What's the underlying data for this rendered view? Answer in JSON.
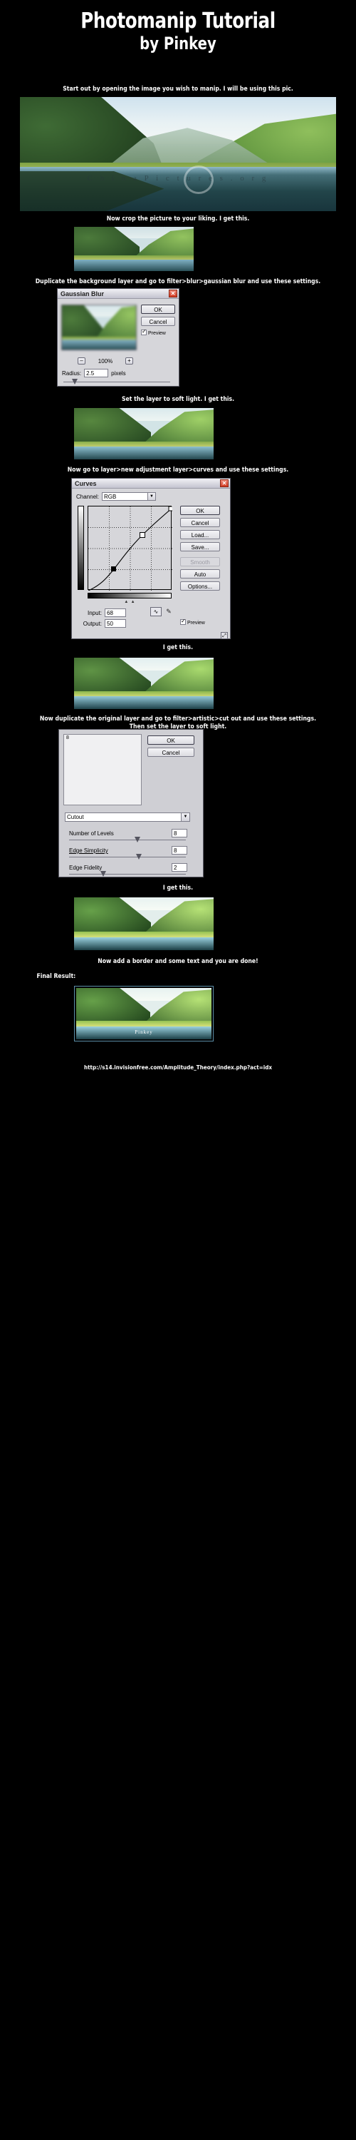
{
  "header": {
    "title": "Photomanip Tutorial",
    "subtitle": "by Pinkey"
  },
  "steps": [
    {
      "id": "step1",
      "text": "Start out by opening the image you wish to manip. I will be using this pic."
    },
    {
      "id": "step2",
      "text": "Now crop the picture to your liking. I get this."
    },
    {
      "id": "step3",
      "text": "Duplicate the background layer and go to filter>blur>gaussian blur and use these settings."
    },
    {
      "id": "step4",
      "text": "Set the layer to soft light. I get this."
    },
    {
      "id": "step5",
      "text": "Now go to layer>new adjustment layer>curves and use these settings."
    },
    {
      "id": "step6",
      "text": "I get this."
    },
    {
      "id": "step7",
      "text": "Now duplicate the original layer and go to filter>artistic>cut out and use these settings. Then set the layer to soft light."
    },
    {
      "id": "step8",
      "text": "I get this."
    },
    {
      "id": "step9",
      "text": "Now add a border and some text and you are done!"
    },
    {
      "id": "step10",
      "text": "Final Result:"
    }
  ],
  "photos": {
    "original": {
      "watermark": "C h i n a P i c t u r e s . o r g"
    },
    "final": {
      "signature": "Pinkey"
    }
  },
  "gaussian_blur": {
    "title": "Gaussian Blur",
    "close_label": "✕",
    "ok": "OK",
    "cancel": "Cancel",
    "preview_label": "Preview",
    "preview_checked": true,
    "zoom_out": "–",
    "zoom_level": "100%",
    "zoom_in": "+",
    "radius_label": "Radius:",
    "radius_value": "2.5",
    "radius_unit": "pixels"
  },
  "curves": {
    "title": "Curves",
    "close_label": "✕",
    "channel_label": "Channel:",
    "channel_value": "RGB",
    "buttons": [
      "OK",
      "Cancel",
      "Load...",
      "Save...",
      "Smooth",
      "Auto",
      "Options..."
    ],
    "smooth_disabled": true,
    "input_label": "Input:",
    "input_value": "68",
    "output_label": "Output:",
    "output_value": "50",
    "preview_label": "Preview",
    "preview_checked": true
  },
  "cutout": {
    "ok": "OK",
    "cancel": "Cancel",
    "zoom_level": "8",
    "filter_name": "Cutout",
    "params": [
      {
        "label": "Number of Levels",
        "value": "8"
      },
      {
        "label": "Edge Simplicity",
        "value": "8"
      },
      {
        "label": "Edge Fidelity",
        "value": "2"
      }
    ]
  },
  "footer": {
    "url": "http://s14.invisionfree.com/Amplitude_Theory/index.php?act=idx"
  },
  "colors": {
    "background": "#000000",
    "text": "#ffffff",
    "dialog_face": "#d6d6da",
    "dialog_border": "#5b5b66",
    "close_red": "#cf3a22",
    "final_border": "#5c8fa8"
  }
}
